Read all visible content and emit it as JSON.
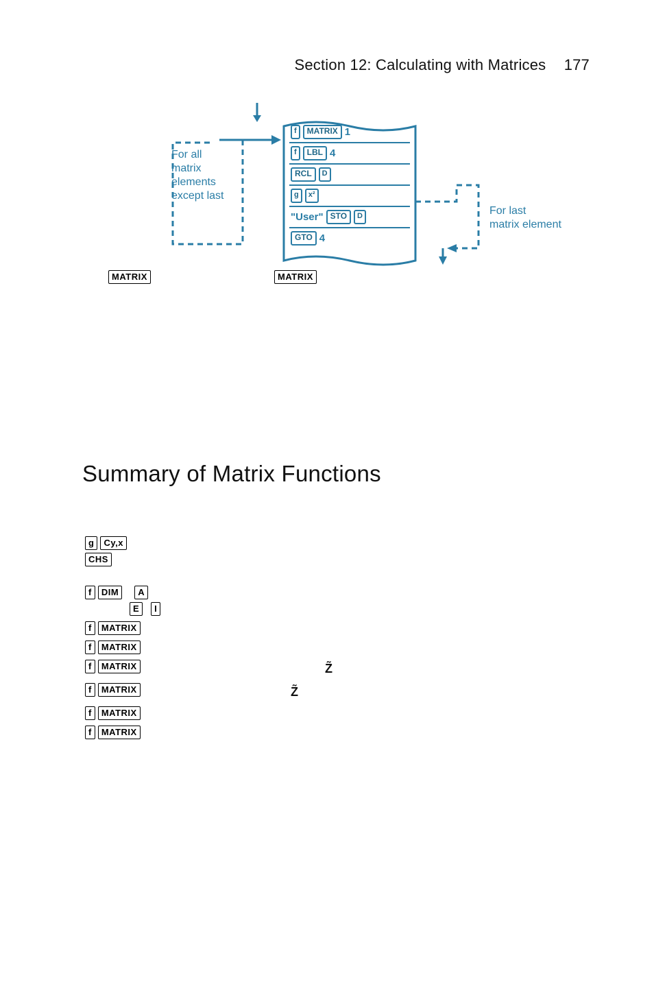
{
  "header": {
    "section": "Section 12: Calculating with Matrices",
    "page": "177"
  },
  "diagram": {
    "left_annotation": "For all\nmatrix\nelements\nexcept last",
    "right_annotation": "For last\nmatrix element",
    "lines": {
      "l1_k1": "f",
      "l1_k2": "MATRIX",
      "l1_n": "1",
      "l2_k1": "f",
      "l2_k2": "LBL",
      "l2_n": "4",
      "l3_k1": "RCL",
      "l3_k2": "D",
      "l4_k1": "g",
      "l4_k2": "x²",
      "l5_txt": "\"User\"",
      "l5_k1": "STO",
      "l5_k2": "D",
      "l6_k1": "GTO",
      "l6_n": "4"
    },
    "below": {
      "m1": "MATRIX",
      "m2": "MATRIX"
    }
  },
  "heading": "Summary of Matrix Functions",
  "keys": {
    "g": "g",
    "cyx": "Cy,x",
    "chs": "CHS",
    "f": "f",
    "dim": "DIM",
    "A": "A",
    "E": "E",
    "I": "I",
    "matrix": "MATRIX"
  },
  "legend": {
    "row3_z": "Z̃",
    "row4_z": "Z̃"
  }
}
